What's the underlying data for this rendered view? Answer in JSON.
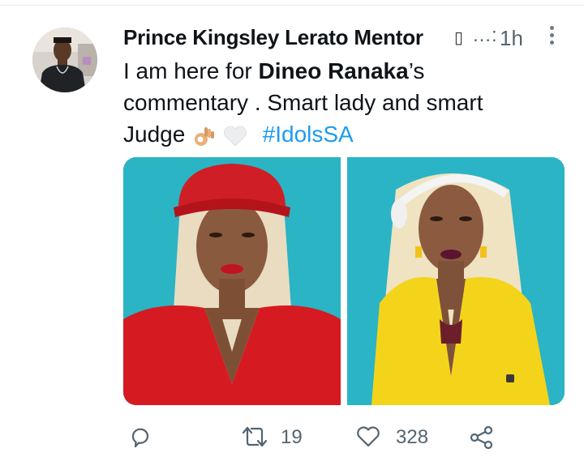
{
  "author": {
    "name": "Prince Kingsley Lerato Mentor",
    "badge": "▯",
    "ellipsis": "…:",
    "timestamp": "1h"
  },
  "tweet": {
    "text_prefix": "I am here for ",
    "mention": "Dineo Ranaka",
    "text_middle": "’s commentary . Smart lady and smart Judge",
    "emojis": [
      "ok-hand-emoji",
      "white-heart-emoji"
    ],
    "hashtag": "#IdolsSA"
  },
  "media": {
    "photos": [
      "woman-in-red-hat-and-red-jacket",
      "woman-in-yellow-jacket-with-headphones"
    ],
    "background_color": "#2ab3c4"
  },
  "actions": {
    "reply": {
      "icon": "reply-icon"
    },
    "retweet": {
      "icon": "retweet-icon",
      "count": "19"
    },
    "like": {
      "icon": "heart-icon",
      "count": "328"
    },
    "share": {
      "icon": "share-icon"
    }
  },
  "colors": {
    "text": "#0f1419",
    "muted": "#536471",
    "link": "#1d9bf0"
  }
}
